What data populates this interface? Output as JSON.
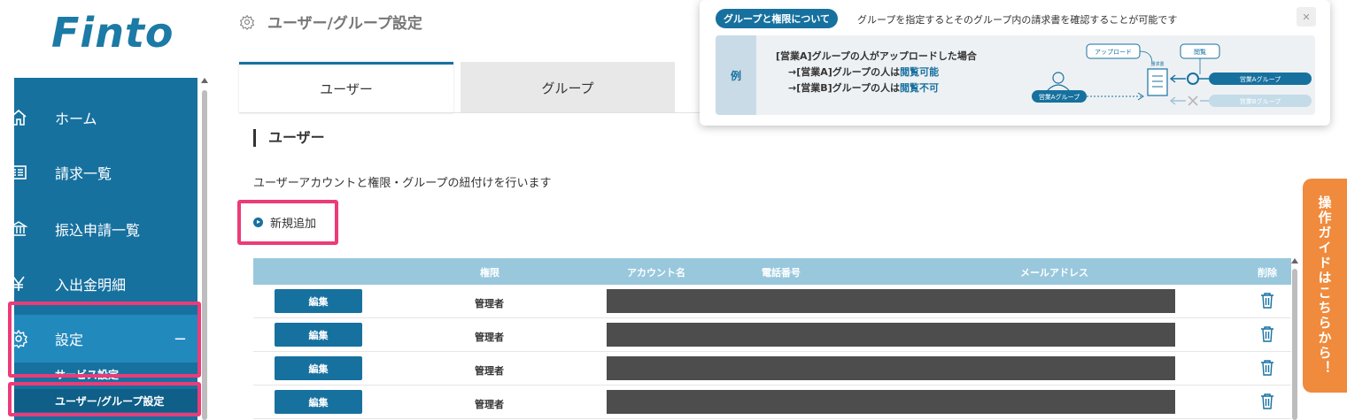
{
  "logo": {
    "text": "Finto"
  },
  "sidebar": {
    "items": [
      {
        "label": "ホーム",
        "icon": "home-icon"
      },
      {
        "label": "請求一覧",
        "icon": "list-icon"
      },
      {
        "label": "振込申請一覧",
        "icon": "bank-icon"
      },
      {
        "label": "入出金明細",
        "icon": "yen-icon"
      },
      {
        "label": "設定",
        "icon": "gear-icon",
        "expanded_symbol": "−"
      }
    ],
    "sub_items": [
      {
        "label": "サービス設定"
      },
      {
        "label": "ユーザー/グループ設定"
      }
    ]
  },
  "header": {
    "title": "ユーザー/グループ設定",
    "icon": "gear-icon"
  },
  "tabs": [
    {
      "label": "ユーザー",
      "active": true
    },
    {
      "label": "グループ",
      "active": false
    }
  ],
  "section": {
    "title": "ユーザー",
    "description": "ユーザーアカウントと権限・グループの紐付けを行います",
    "add_label": "新規追加"
  },
  "table": {
    "columns": [
      "権限",
      "アカウント名",
      "電話番号",
      "メールアドレス",
      "削除"
    ],
    "edit_label": "編集",
    "rows": [
      {
        "role": "管理者"
      },
      {
        "role": "管理者"
      },
      {
        "role": "管理者"
      },
      {
        "role": "管理者"
      }
    ]
  },
  "guide": {
    "label": "操作ガイドはこちらから！"
  },
  "popup": {
    "pill": "グループと権限について",
    "text": "グループを指定するとそのグループ内の請求書を確認することが可能です",
    "close": "✕",
    "example_label": "例",
    "line1": "[営業A]グループの人がアップロードした場合",
    "line2_prefix": "→[営業A]グループの人は",
    "line2_em": "閲覧可能",
    "line3_prefix": "→[営業B]グループの人は",
    "line3_em": "閲覧不可",
    "diagram": {
      "upload": "アップロード",
      "view": "閲覧",
      "doc": "請求書",
      "group_a_left": "営業Aグループ",
      "group_a_right": "営業Aグループ",
      "group_b_right": "営業Bグループ"
    }
  },
  "colors": {
    "brand": "#17719f",
    "sidebar_active": "#2289bd",
    "highlight": "#ec3b78",
    "table_header": "#99c8dd",
    "guide": "#f08a3c"
  }
}
